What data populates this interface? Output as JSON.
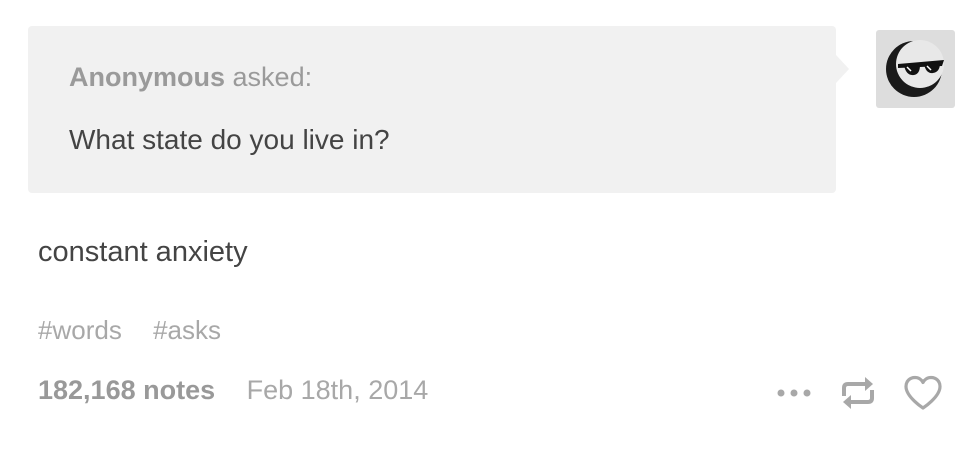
{
  "ask": {
    "asker": "Anonymous",
    "asked_label": "asked:",
    "question": "What state do you live in?"
  },
  "avatar": {
    "icon": "sunglasses-face-icon"
  },
  "post": {
    "answer": "constant anxiety",
    "tags": [
      "#words",
      "#asks"
    ]
  },
  "footer": {
    "notes": "182,168 notes",
    "date": "Feb 18th, 2014",
    "actions": {
      "more_icon": "more-icon",
      "reblog_icon": "reblog-icon",
      "like_icon": "heart-icon"
    }
  },
  "colors": {
    "bubble_bg": "#f1f1f1",
    "text_dark": "#444444",
    "text_muted": "#a8a8a8"
  }
}
